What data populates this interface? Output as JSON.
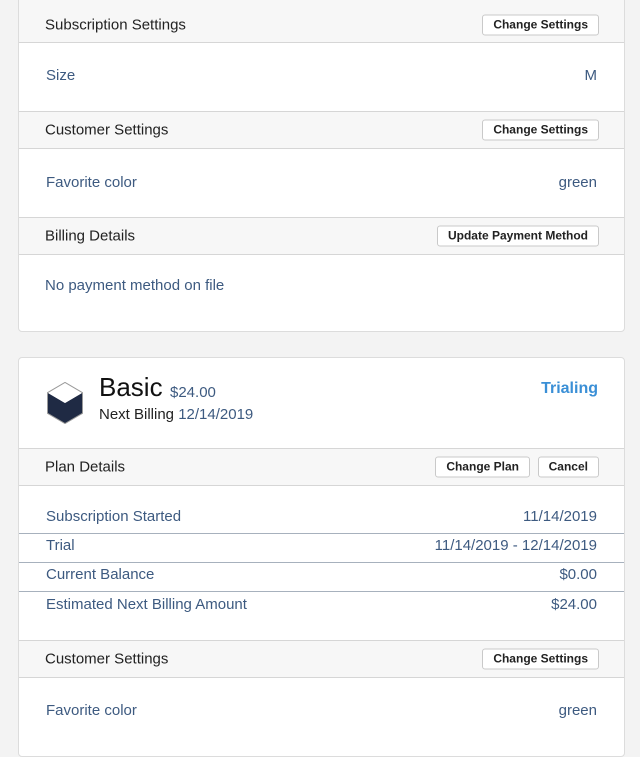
{
  "subscription_settings": {
    "title": "Subscription Settings",
    "button": "Change Settings",
    "rows": [
      {
        "label": "Size",
        "value": "M"
      }
    ]
  },
  "customer_settings_1": {
    "title": "Customer Settings",
    "button": "Change Settings",
    "rows": [
      {
        "label": "Favorite color",
        "value": "green"
      }
    ]
  },
  "billing_details": {
    "title": "Billing Details",
    "button": "Update Payment Method",
    "empty_text": "No payment method on file"
  },
  "plan": {
    "icon": "cube-icon",
    "name": "Basic",
    "price": "$24.00",
    "next_billing_label": "Next Billing",
    "next_billing_date": "12/14/2019",
    "status": "Trialing",
    "status_color": "#3a8fd6"
  },
  "plan_details": {
    "title": "Plan Details",
    "change_button": "Change Plan",
    "cancel_button": "Cancel",
    "rows": [
      {
        "label": "Subscription Started",
        "value": "11/14/2019"
      },
      {
        "label": "Trial",
        "value": "11/14/2019 - 12/14/2019"
      },
      {
        "label": "Current Balance",
        "value": "$0.00"
      },
      {
        "label": "Estimated Next Billing Amount",
        "value": "$24.00"
      }
    ]
  },
  "customer_settings_2": {
    "title": "Customer Settings",
    "button": "Change Settings",
    "rows": [
      {
        "label": "Favorite color",
        "value": "green"
      }
    ]
  }
}
